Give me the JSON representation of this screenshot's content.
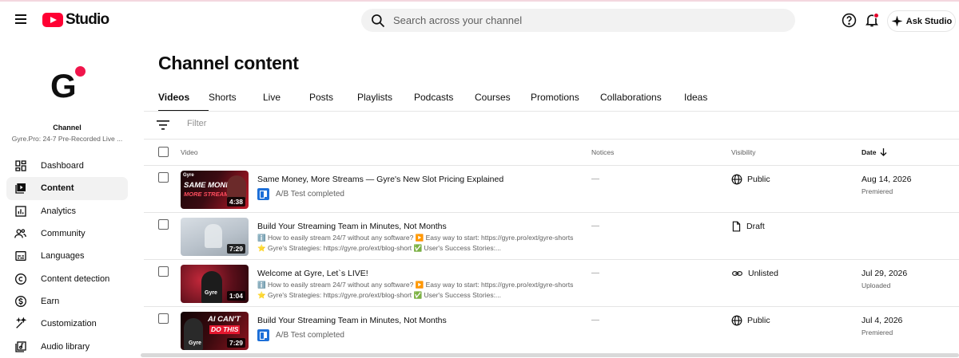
{
  "header": {
    "logo_text": "Studio",
    "search_placeholder": "Search across your channel",
    "ask_label": "Ask Studio"
  },
  "sidebar": {
    "avatar_letter": "G",
    "channel_label": "Channel",
    "channel_name": "Gyre.Pro: 24-7 Pre-Recorded Live ...",
    "items": [
      {
        "label": "Dashboard",
        "icon": "dashboard-icon"
      },
      {
        "label": "Content",
        "icon": "content-icon",
        "active": true
      },
      {
        "label": "Analytics",
        "icon": "analytics-icon"
      },
      {
        "label": "Community",
        "icon": "community-icon"
      },
      {
        "label": "Languages",
        "icon": "languages-icon"
      },
      {
        "label": "Content detection",
        "icon": "copyright-icon"
      },
      {
        "label": "Earn",
        "icon": "earn-icon"
      },
      {
        "label": "Customization",
        "icon": "customization-icon"
      },
      {
        "label": "Audio library",
        "icon": "audio-library-icon"
      }
    ]
  },
  "main": {
    "title": "Channel content",
    "tabs": [
      "Videos",
      "Shorts",
      "Live",
      "Posts",
      "Playlists",
      "Podcasts",
      "Courses",
      "Promotions",
      "Collaborations",
      "Ideas"
    ],
    "active_tab": "Videos",
    "filter_placeholder": "Filter",
    "columns": {
      "video": "Video",
      "notices": "Notices",
      "visibility": "Visibility",
      "date": "Date"
    }
  },
  "videos": [
    {
      "title": "Same Money, More Streams — Gyre's New Slot Pricing Explained",
      "duration": "4:38",
      "thumb_text": [
        "SAME MONEY",
        "MORE STREAMS"
      ],
      "thumb_brand": "Gyre",
      "extra": "A/B Test completed",
      "notices": "—",
      "visibility": "Public",
      "date": "Aug 14, 2026",
      "date_status": "Premiered"
    },
    {
      "title": "Build Your Streaming Team in Minutes, Not Months",
      "duration": "7:29",
      "desc1": "ℹ️ How to easily stream 24/7 without any software? ▶️ Easy way to start: https://gyre.pro/ext/gyre-shorts",
      "desc2": "⭐ Gyre's Strategies: https://gyre.pro/ext/blog-short ✅ User's Success Stories:...",
      "notices": "—",
      "visibility": "Draft",
      "date": "",
      "date_status": ""
    },
    {
      "title": "Welcome at Gyre, Let`s LIVE!",
      "duration": "1:04",
      "thumb_brand": "Gyre",
      "desc1": "ℹ️ How to easily stream 24/7 without any software? ▶️ Easy way to start: https://gyre.pro/ext/gyre-shorts",
      "desc2": "⭐ Gyre's Strategies: https://gyre.pro/ext/blog-short ✅ User's Success Stories:...",
      "notices": "—",
      "visibility": "Unlisted",
      "date": "Jul 29, 2026",
      "date_status": "Uploaded"
    },
    {
      "title": "Build Your Streaming Team in Minutes, Not Months",
      "duration": "7:29",
      "thumb_text": [
        "AI CAN'T",
        "DO THIS"
      ],
      "thumb_brand": "Gyre",
      "extra": "A/B Test completed",
      "notices": "—",
      "visibility": "Public",
      "date": "Jul 4, 2026",
      "date_status": "Premiered"
    }
  ],
  "colors": {
    "brand": "#ff0033",
    "accent": "#1d6fd8",
    "avatar_dot": "#f0154b"
  }
}
